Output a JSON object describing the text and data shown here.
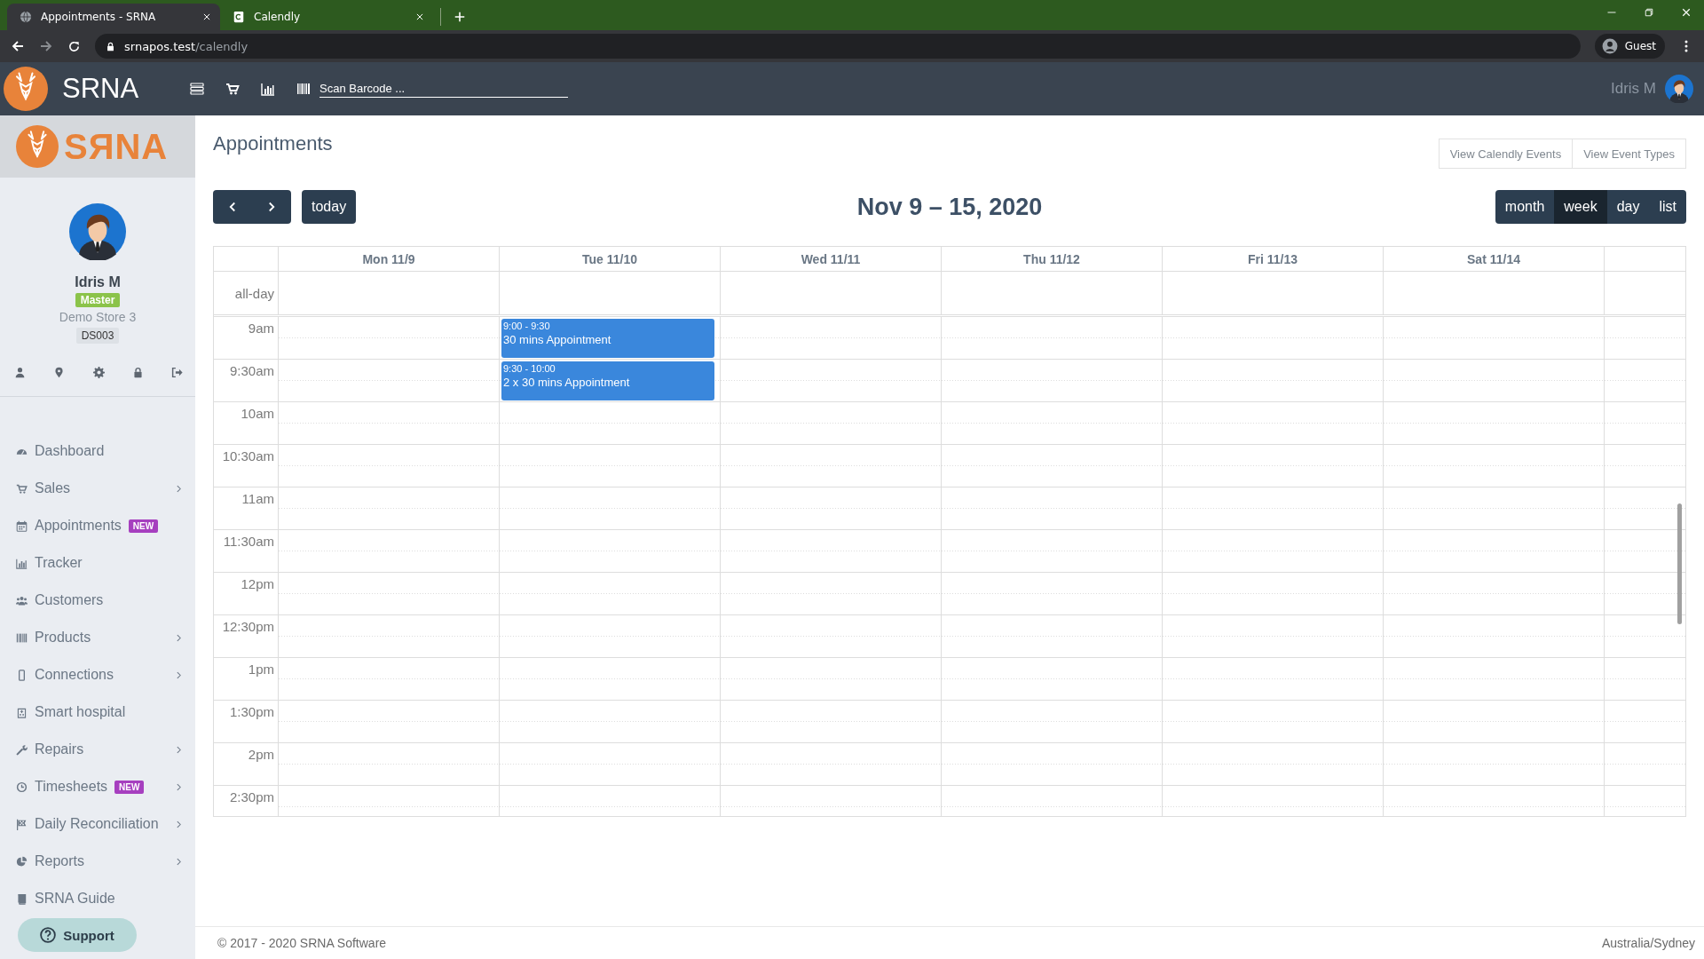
{
  "browser": {
    "tabs": [
      {
        "title": "Appointments - SRNA",
        "selected": true
      },
      {
        "title": "Calendly",
        "selected": false
      }
    ],
    "url": {
      "host": "srnapos.test",
      "path": "/calendly"
    },
    "profile": "Guest"
  },
  "header": {
    "brand": "SRNA",
    "barcode_field": {
      "placeholder": "Scan Barcode ..."
    },
    "user": "Idris M"
  },
  "sidebar": {
    "logo": "SЯNA",
    "profile": {
      "name": "Idris M",
      "role": "Master",
      "store": "Demo Store 3",
      "code": "DS003"
    },
    "menu": [
      {
        "label": "Dashboard",
        "submenu": false
      },
      {
        "label": "Sales",
        "submenu": true
      },
      {
        "label": "Appointments",
        "badge": "NEW",
        "submenu": false
      },
      {
        "label": "Tracker",
        "submenu": false
      },
      {
        "label": "Customers",
        "submenu": false
      },
      {
        "label": "Products",
        "submenu": true
      },
      {
        "label": "Connections",
        "submenu": true
      },
      {
        "label": "Smart hospital",
        "submenu": false
      },
      {
        "label": "Repairs",
        "submenu": true
      },
      {
        "label": "Timesheets",
        "badge": "NEW",
        "submenu": true
      },
      {
        "label": "Daily Reconciliation",
        "submenu": true
      },
      {
        "label": "Reports",
        "submenu": true
      },
      {
        "label": "SRNA Guide",
        "submenu": false
      }
    ],
    "support": "Support"
  },
  "page": {
    "title": "Appointments",
    "actions": [
      "View Calendly Events",
      "View Event Types"
    ]
  },
  "calendar": {
    "range": "Nov 9 – 15, 2020",
    "today": "today",
    "views": [
      {
        "label": "month",
        "selected": false
      },
      {
        "label": "week",
        "selected": true
      },
      {
        "label": "day",
        "selected": false
      },
      {
        "label": "list",
        "selected": false
      }
    ],
    "all_day": "all-day",
    "days": [
      {
        "label": "Mon 11/9"
      },
      {
        "label": "Tue 11/10",
        "events": [
          {
            "time": "9:00 - 9:30",
            "title": "30 mins Appointment"
          },
          {
            "time": "9:30 - 10:00",
            "title": "2 x 30 mins Appointment"
          }
        ]
      },
      {
        "label": "Wed 11/11"
      },
      {
        "label": "Thu 11/12"
      },
      {
        "label": "Fri 11/13"
      },
      {
        "label": "Sat 11/14"
      }
    ],
    "times": [
      "9am",
      "9:30am",
      "10am",
      "10:30am",
      "11am",
      "11:30am",
      "12pm",
      "12:30pm",
      "1pm",
      "1:30pm",
      "2pm",
      "2:30pm"
    ]
  },
  "footer": {
    "copyright": "© 2017 - 2020 SRNA Software",
    "timezone": "Australia/Sydney"
  }
}
